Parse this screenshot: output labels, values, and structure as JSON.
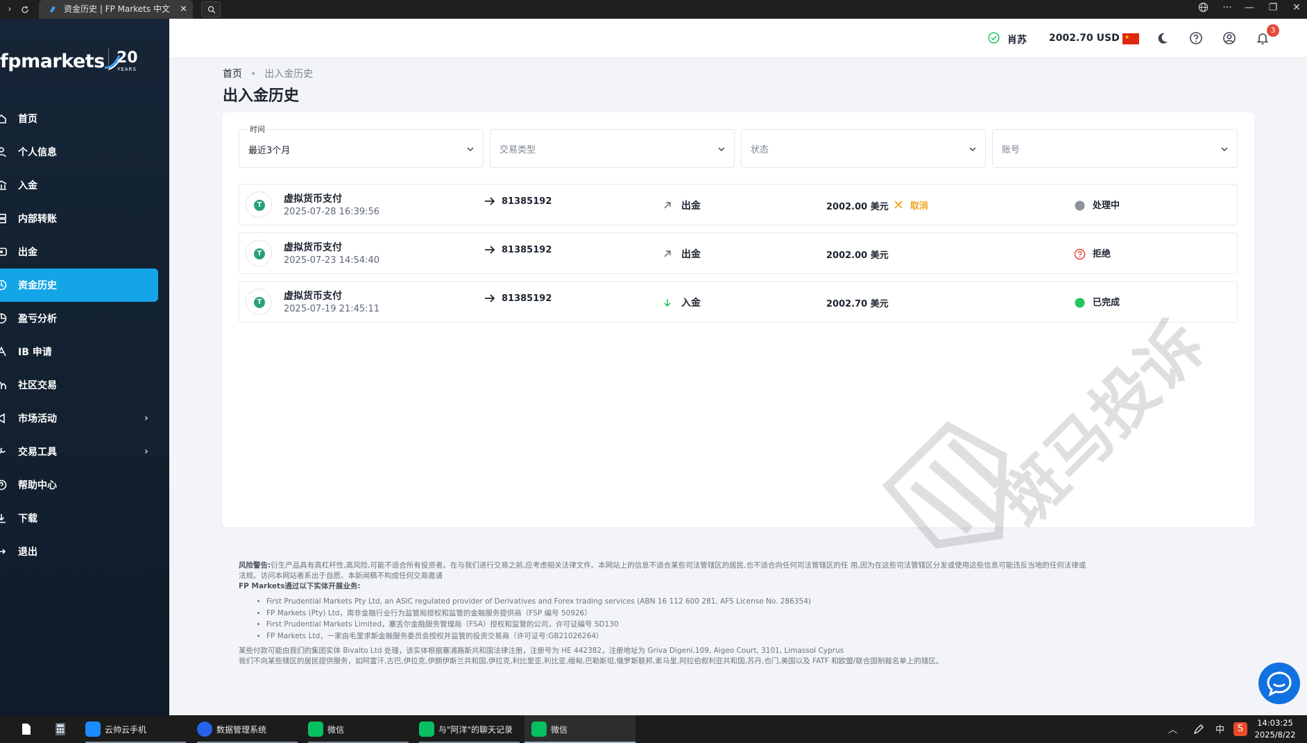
{
  "browser": {
    "tab_title": "资金历史 | FP Markets 中文",
    "colors": {
      "bar": "#1f1f1f",
      "tab": "#3a3a3a"
    }
  },
  "sidebar": {
    "logo_text": "fpmarkets",
    "logo_20": "20",
    "logo_years": "YEARS",
    "items": [
      {
        "label": "首页",
        "icon": "home-icon"
      },
      {
        "label": "个人信息",
        "icon": "user-icon"
      },
      {
        "label": "入金",
        "icon": "bank-icon"
      },
      {
        "label": "内部转账",
        "icon": "transfer-icon"
      },
      {
        "label": "出金",
        "icon": "withdraw-icon"
      },
      {
        "label": "资金历史",
        "icon": "history-icon",
        "active": true
      },
      {
        "label": "盈亏分析",
        "icon": "pie-chart-icon"
      },
      {
        "label": "IB 申请",
        "icon": "ib-icon"
      },
      {
        "label": "社区交易",
        "icon": "community-icon"
      },
      {
        "label": "市场活动",
        "icon": "campaign-icon",
        "has_submenu": true
      },
      {
        "label": "交易工具",
        "icon": "tools-icon",
        "has_submenu": true
      },
      {
        "label": "帮助中心",
        "icon": "help-icon"
      },
      {
        "label": "下载",
        "icon": "download-icon"
      },
      {
        "label": "退出",
        "icon": "logout-icon"
      }
    ],
    "colors": {
      "bg": "#162537",
      "active": "#13a5e6"
    }
  },
  "header": {
    "user_name": "肖苏",
    "balance": "2002.70 USD",
    "notification_count": "3",
    "icons": [
      "verified-icon",
      "china-flag-icon",
      "dark-mode-icon",
      "help-icon",
      "account-icon",
      "bell-icon"
    ]
  },
  "breadcrumb": {
    "home": "首页",
    "current": "出入金历史"
  },
  "page_title": "出入金历史",
  "filters": [
    {
      "label": "时间",
      "value": "最近3个月"
    },
    {
      "placeholder": "交易类型"
    },
    {
      "placeholder": "状态"
    },
    {
      "placeholder": "账号"
    }
  ],
  "transactions": [
    {
      "method": "虚拟货币支付",
      "time": "2025-07-28 16:39:56",
      "account": "81385192",
      "direction": "出金",
      "direction_icon": "arrow-up-right-icon",
      "amount": "2002.00 美元",
      "cancel": "取消",
      "status": "处理中",
      "status_icon": "pending-dot-icon",
      "status_color": "#8b929c"
    },
    {
      "method": "虚拟货币支付",
      "time": "2025-07-23 14:54:40",
      "account": "81385192",
      "direction": "出金",
      "direction_icon": "arrow-up-right-icon",
      "amount": "2002.00 美元",
      "status": "拒绝",
      "status_icon": "question-circle-icon",
      "status_color": "#e5483b"
    },
    {
      "method": "虚拟货币支付",
      "time": "2025-07-19 21:45:11",
      "account": "81385192",
      "direction": "入金",
      "direction_icon": "arrow-down-icon",
      "amount": "2002.70 美元",
      "status": "已完成",
      "status_icon": "success-dot-icon",
      "status_color": "#22c55e"
    }
  ],
  "footer": {
    "warning_title": "风险警告:",
    "warning_text": "衍生产品具有高杠杆性,高风险,可能不适合所有投资者。在与我们进行交易之前,应考虑相关法律文件。本网站上的信息不适合某些司法管辖区的居民,也不适合向任何司法管辖区的任",
    "warning_text_tail": "用,因为在这些司法管辖区分发或使用这些信息可能违反当地的任何法律或",
    "warning_text_2": "法规。访问本网站者系出于自愿。本新闻稿不构成任何交易邀请",
    "entities_title": "FP Markets通过以下实体开展业务:",
    "entities": [
      "First Prudential Markets Pty Ltd, an ASIC regulated provider of Derivatives and Forex trading services (ABN 16 112 600 281, AFS License No. 286354)",
      "FP Markets (Pty) Ltd，南非金融行业行为监管局授权和监管的金融服务提供商（FSP 编号 50926）",
      "First Prudential Markets Limited，塞舌尔金融服务管理局（FSA）授权和监管的公司，许可证编号 SD130",
      "FP Markets Ltd，一家由毛里求斯金融服务委员会授权并监管的投资交易商（许可证号:GB21026264）"
    ],
    "payment_text": "某些付款可能由我们的集团实体 Bivalto Ltd 处理，该实体根据塞浦路斯共和国法律注册，注册号为 HE 442382，注册地址为 Griva Digeni,109, Aigeo Court, 3101, Limassol Cyprus",
    "restricted_text": "我们不向某些辖区的居民提供服务，如阿富汗,古巴,伊拉克,伊朗伊斯兰共和国,伊拉克,利比里亚,利比亚,缅甸,巴勒斯坦,俄罗斯联邦,索马里,阿拉伯叙利亚共和国,苏丹,也门,美国以及 FATF 和欧盟/联合国制裁名单上的辖区。"
  },
  "watermark_text": "斑马投诉",
  "taskbar": {
    "apps": [
      {
        "label": "云帅云手机",
        "color": "#1a8cff"
      },
      {
        "label": "数据管理系统",
        "color": "#2563eb"
      },
      {
        "label": "微信",
        "color": "#07c160"
      },
      {
        "label": "与\"阿洋\"的聊天记录",
        "color": "#07c160"
      },
      {
        "label": "微信",
        "color": "#07c160"
      }
    ],
    "ime": "中",
    "time": "14:03:25",
    "date": "2025/8/22"
  }
}
